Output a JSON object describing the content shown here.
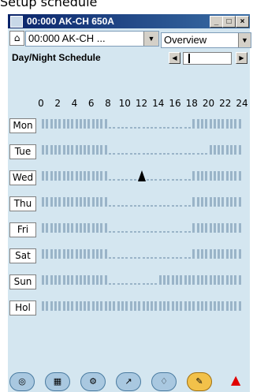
{
  "caption": "Setup schedule",
  "window": {
    "title": "00:000 AK-CH 650A",
    "min_btn": "_",
    "max_btn": "□",
    "close_btn": "×"
  },
  "nav": {
    "device_combo_value": "00:000 AK-CH ...",
    "view_combo_value": "Overview"
  },
  "schedule": {
    "title": "Day/Night Schedule",
    "hours": [
      "0",
      "2",
      "4",
      "6",
      "8",
      "10",
      "12",
      "14",
      "16",
      "18",
      "20",
      "22",
      "24"
    ],
    "days": [
      "Mon",
      "Tue",
      "Wed",
      "Thu",
      "Fri",
      "Sat",
      "Sun",
      "Hol"
    ],
    "day_on": [
      [
        0,
        8,
        18,
        24
      ],
      [
        0,
        8,
        20,
        24
      ],
      [
        0,
        8,
        18,
        24
      ],
      [
        0,
        8,
        18,
        24
      ],
      [
        0,
        8,
        18,
        24
      ],
      [
        0,
        8,
        18,
        24
      ],
      [
        0,
        8,
        14,
        24
      ],
      [
        0,
        24,
        0,
        0
      ]
    ]
  },
  "bottom_tools": [
    {
      "icon": "overview-icon"
    },
    {
      "icon": "table-icon"
    },
    {
      "icon": "tools-icon"
    },
    {
      "icon": "graph-icon"
    },
    {
      "icon": "bell-outline-icon"
    },
    {
      "icon": "wrench-icon",
      "active": true
    }
  ],
  "colors": {
    "background": "#d4e6f0",
    "on_bar": "#9ab4c8",
    "active_tool": "#f2c14a",
    "alarm": "#e00000"
  }
}
